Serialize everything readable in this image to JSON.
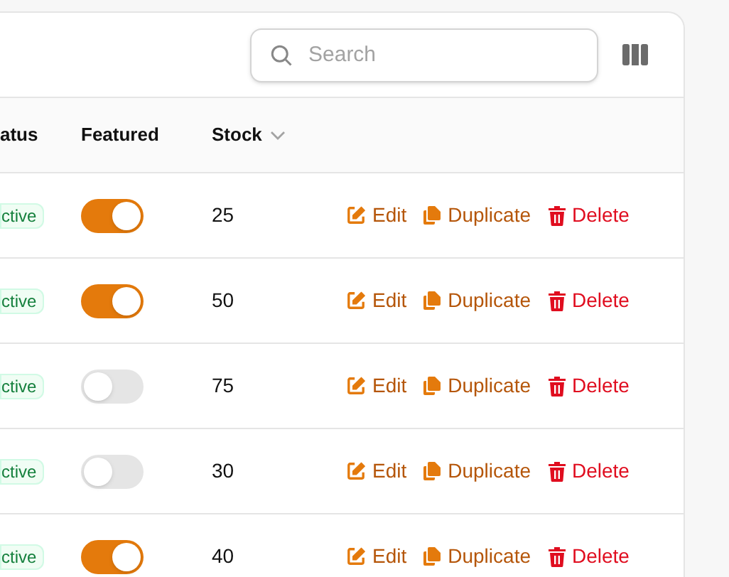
{
  "search": {
    "placeholder": "Search"
  },
  "table": {
    "columns": [
      {
        "label": "atus",
        "sortable": false
      },
      {
        "label": "Featured",
        "sortable": false
      },
      {
        "label": "Stock",
        "sortable": true
      }
    ],
    "rows": [
      {
        "status": "ctive",
        "featured": true,
        "stock": "25",
        "actions": [
          "Edit",
          "Duplicate",
          "Delete"
        ]
      },
      {
        "status": "ctive",
        "featured": true,
        "stock": "50",
        "actions": [
          "Edit",
          "Duplicate",
          "Delete"
        ]
      },
      {
        "status": "ctive",
        "featured": false,
        "stock": "75",
        "actions": [
          "Edit",
          "Duplicate",
          "Delete"
        ]
      },
      {
        "status": "ctive",
        "featured": false,
        "stock": "30",
        "actions": [
          "Edit",
          "Duplicate",
          "Delete"
        ]
      },
      {
        "status": "ctive",
        "featured": true,
        "stock": "40",
        "actions": [
          "Edit",
          "Duplicate",
          "Delete"
        ]
      }
    ]
  }
}
